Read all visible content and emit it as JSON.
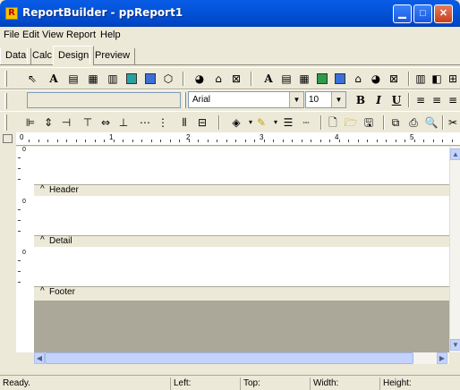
{
  "window": {
    "title": "ReportBuilder - ppReport1",
    "app_icon_letter": "R"
  },
  "menu": [
    "File",
    "Edit",
    "View",
    "Report",
    "Help"
  ],
  "tabs": [
    "Data",
    "Calc",
    "Design",
    "Preview"
  ],
  "active_tab": "Design",
  "toolbar2": {
    "font_name": "Arial",
    "font_size": "10",
    "bold": "B",
    "italic": "I",
    "underline": "U"
  },
  "ruler": {
    "numbers": [
      "0",
      "1",
      "2",
      "3",
      "4",
      "5"
    ]
  },
  "left_ruler": {
    "zero_label": "0"
  },
  "bands": [
    {
      "name": "Header",
      "caret": "^"
    },
    {
      "name": "Detail",
      "caret": "^"
    },
    {
      "name": "Footer",
      "caret": "^"
    }
  ],
  "status": {
    "state": "Ready.",
    "left": "Left:",
    "top": "Top:",
    "width": "Width:",
    "height": "Height:"
  }
}
